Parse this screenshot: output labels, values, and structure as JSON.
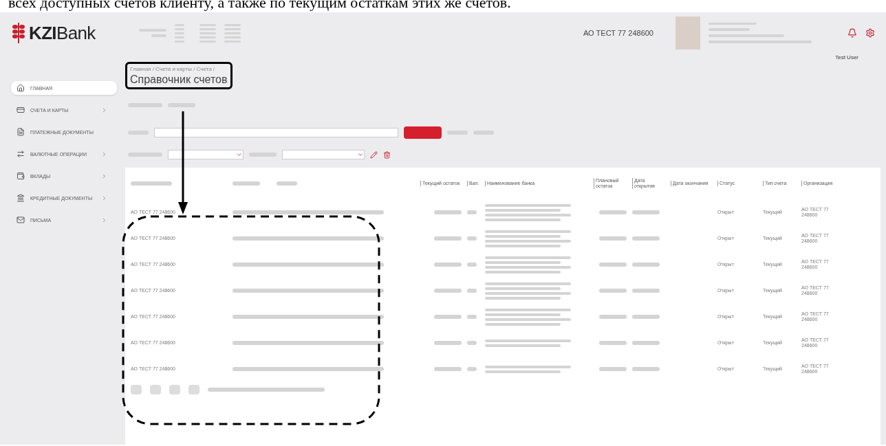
{
  "caption": "всех доступных счетов клиенту, а также по текущим остаткам этих же счетов.",
  "header": {
    "logo_bold": "KZI",
    "logo_rest": "Bank",
    "company": "АО ТЕСТ 77 248600"
  },
  "user": "Test User",
  "sidebar": {
    "items": [
      {
        "label": "ГЛАВНАЯ",
        "selected": true,
        "expandable": false
      },
      {
        "label": "СЧЕТА И КАРТЫ",
        "selected": false,
        "expandable": true
      },
      {
        "label": "ПЛАТЕЖНЫЕ ДОКУМЕНТЫ",
        "selected": false,
        "expandable": false
      },
      {
        "label": "ВАЛЮТНЫЕ ОПЕРАЦИИ",
        "selected": false,
        "expandable": true
      },
      {
        "label": "ВКЛАДЫ",
        "selected": false,
        "expandable": true
      },
      {
        "label": "КРЕДИТНЫЕ ДОКУМЕНТЫ",
        "selected": false,
        "expandable": true
      },
      {
        "label": "ПИСЬМА",
        "selected": false,
        "expandable": true
      }
    ]
  },
  "page": {
    "breadcrumb": "Главная / Счета и карты / Счета /",
    "title": "Справочник счетов"
  },
  "table": {
    "columns": [
      "Текущий остаток",
      "Вал.",
      "Наименование банка",
      "Плановый остаток",
      "Дата открытия",
      "Дата окончания",
      "Статус",
      "Тип счета",
      "Организация"
    ],
    "rows": [
      {
        "owner": "АО ТЕСТ 77 248600",
        "status": "Открыт",
        "type": "Текущий",
        "org": "АО ТЕСТ 77 248600"
      },
      {
        "owner": "АО ТЕСТ 77 248600",
        "status": "Открыт",
        "type": "Текущий",
        "org": "АО ТЕСТ 77 248600"
      },
      {
        "owner": "АО ТЕСТ 77 248600",
        "status": "Открыт",
        "type": "Текущий",
        "org": "АО ТЕСТ 77 248600"
      },
      {
        "owner": "АО ТЕСТ 77 248600",
        "status": "Открыт",
        "type": "Текущий",
        "org": "АО ТЕСТ 77 248600"
      },
      {
        "owner": "АО ТЕСТ 77 248600",
        "status": "Открыт",
        "type": "Текущий",
        "org": "АО ТЕСТ 77 248600"
      },
      {
        "owner": "АО ТЕСТ 77 248600",
        "status": "Открыт",
        "type": "Текущий",
        "org": "АО ТЕСТ 77 248600"
      },
      {
        "owner": "АО ТЕСТ 77 248600",
        "status": "Открыт",
        "type": "Текущий",
        "org": "АО ТЕСТ 77 248600"
      }
    ]
  }
}
